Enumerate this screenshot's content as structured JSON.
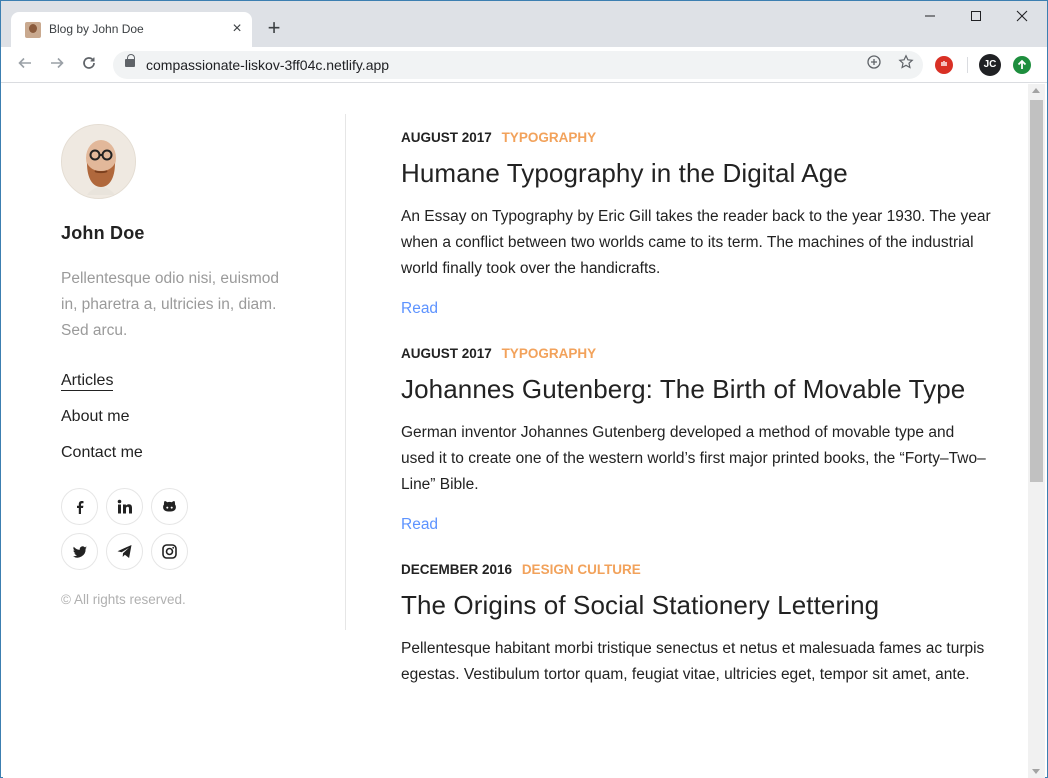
{
  "browser": {
    "tab_title": "Blog by John Doe",
    "tab_close": "×",
    "new_tab": "+",
    "url": "compassionate-liskov-3ff04c.netlify.app",
    "profile_initials": "JC"
  },
  "sidebar": {
    "author_name": "John Doe",
    "bio": "Pellentesque odio nisi, euismod in, pharetra a, ultricies in, diam. Sed arcu.",
    "menu": [
      "Articles",
      "About me",
      "Contact me"
    ],
    "socials": [
      "facebook-icon",
      "linkedin-icon",
      "github-icon",
      "twitter-icon",
      "telegram-icon",
      "instagram-icon"
    ],
    "copyright": "© All rights reserved."
  },
  "posts": [
    {
      "date": "AUGUST 2017",
      "category": "TYPOGRAPHY",
      "title": "Humane Typography in the Digital Age",
      "excerpt": "An Essay on Typography by Eric Gill takes the reader back to the year 1930. The year when a conflict between two worlds came to its term. The machines of the industrial world finally took over the handicrafts.",
      "read_label": "Read"
    },
    {
      "date": "AUGUST 2017",
      "category": "TYPOGRAPHY",
      "title": "Johannes Gutenberg: The Birth of Movable Type",
      "excerpt": "German inventor Johannes Gutenberg developed a method of movable type and used it to create one of the western world’s first major printed books, the “Forty–Two–Line” Bible.",
      "read_label": "Read"
    },
    {
      "date": "DECEMBER 2016",
      "category": "DESIGN CULTURE",
      "title": "The Origins of Social Stationery Lettering",
      "excerpt": "Pellentesque habitant morbi tristique senectus et netus et malesuada fames ac turpis egestas. Vestibulum tortor quam, feugiat vitae, ultricies eget, tempor sit amet, ante."
    }
  ],
  "colors": {
    "category": "#f2a25b",
    "read_link": "#5d93ff",
    "text": "#222222",
    "muted": "#9a9a9a"
  }
}
